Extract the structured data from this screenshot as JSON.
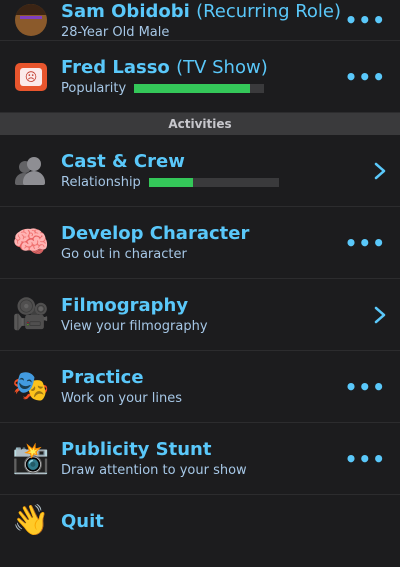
{
  "header_rows": [
    {
      "name": "Sam Obidobi",
      "role": "(Recurring Role)",
      "subtitle": "28-Year Old Male",
      "icon": "avatar-icon"
    },
    {
      "name": "Fred Lasso",
      "role": "(TV Show)",
      "subtitle": "Popularity",
      "popularity": 0.89,
      "icon": "tv-icon"
    }
  ],
  "section": {
    "title": "Activities"
  },
  "activities": [
    {
      "title": "Cast & Crew",
      "subtitle": "Relationship",
      "relationship": 0.34,
      "action": "chevron",
      "icon": "silhouette-icon"
    },
    {
      "title": "Develop Character",
      "subtitle": "Go out in character",
      "action": "more",
      "icon": "brain-icon"
    },
    {
      "title": "Filmography",
      "subtitle": "View your filmography",
      "action": "chevron",
      "icon": "film-camera-icon"
    },
    {
      "title": "Practice",
      "subtitle": "Work on your lines",
      "action": "more",
      "icon": "theater-masks-icon"
    },
    {
      "title": "Publicity Stunt",
      "subtitle": "Draw attention to your show",
      "action": "more",
      "icon": "camera-flash-icon"
    },
    {
      "title": "Quit",
      "icon": "waving-hand-icon"
    }
  ],
  "colors": {
    "background": "#1c1c1e",
    "accent": "#5ac8fa",
    "progress": "#34c759",
    "progress_track": "#3a3a3c"
  }
}
